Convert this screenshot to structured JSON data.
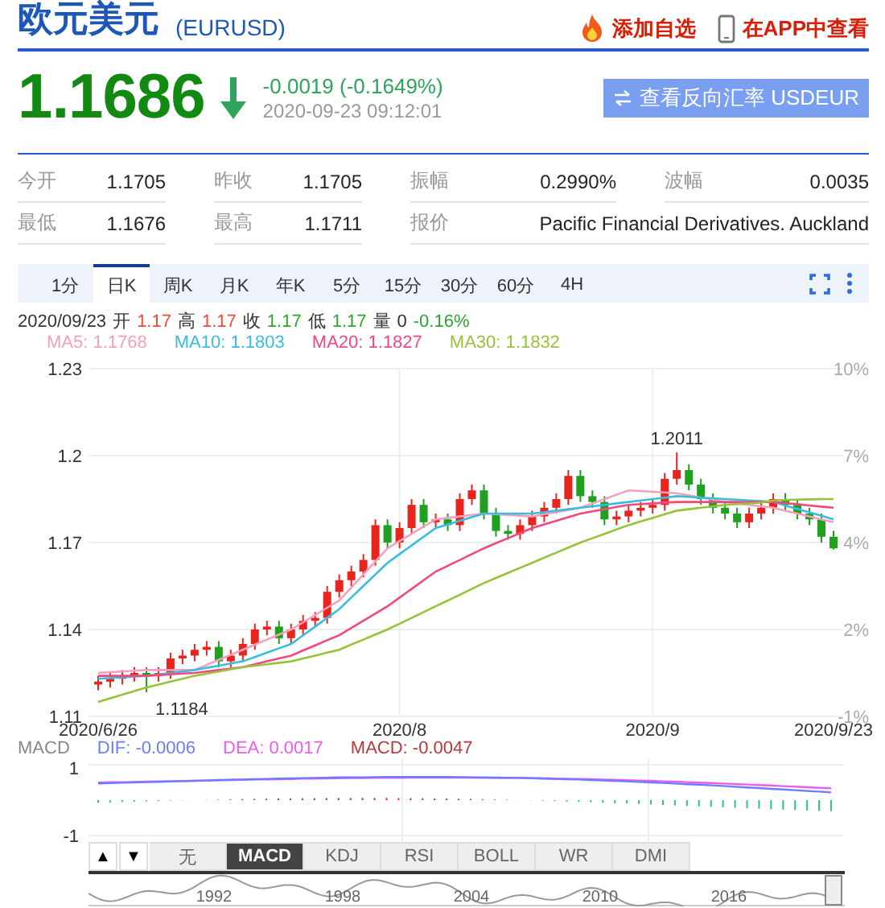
{
  "header": {
    "title": "欧元美元",
    "code": "(EURUSD)",
    "actions": [
      {
        "kind": "watch",
        "label": "添加自选"
      },
      {
        "kind": "app",
        "label": "在APP中查看"
      }
    ]
  },
  "quote": {
    "price": "1.1686",
    "falling": true,
    "change": "-0.0019 (-0.1649%)",
    "time": "2020-09-23 09:12:01",
    "reverse_button": "查看反向汇率 USDEUR"
  },
  "stats": [
    [
      {
        "label": "今开",
        "value": "1.1705"
      },
      {
        "label": "昨收",
        "value": "1.1705"
      },
      {
        "label": "振幅",
        "value": "0.2990%"
      },
      {
        "label": "波幅",
        "value": "0.0035"
      }
    ],
    [
      {
        "label": "最低",
        "value": "1.1676"
      },
      {
        "label": "最高",
        "value": "1.1711"
      },
      {
        "label": "报价",
        "value": "Pacific Financial Derivatives. Auckland"
      }
    ]
  ],
  "period_tabs": [
    {
      "label": "1分",
      "selected": false
    },
    {
      "label": "日K",
      "selected": true
    },
    {
      "label": "周K",
      "selected": false
    },
    {
      "label": "月K",
      "selected": false
    },
    {
      "label": "年K",
      "selected": false
    },
    {
      "label": "5分",
      "selected": false
    },
    {
      "label": "15分",
      "selected": false
    },
    {
      "label": "30分",
      "selected": false
    },
    {
      "label": "60分",
      "selected": false
    },
    {
      "label": "4H",
      "selected": false
    }
  ],
  "quote_line": {
    "date": "2020/09/23",
    "fields": [
      {
        "label": "开",
        "value": "1.17",
        "color": "#f04a3a"
      },
      {
        "label": "高",
        "value": "1.17",
        "color": "#f04a3a"
      },
      {
        "label": "收",
        "value": "1.17",
        "color": "#2ea52e"
      },
      {
        "label": "低",
        "value": "1.17",
        "color": "#2ea52e"
      },
      {
        "label": "量",
        "value": "0",
        "color": "#333333"
      },
      {
        "value": "-0.16%",
        "color": "#2ea52e"
      }
    ]
  },
  "price_chart": {
    "chart_data": {
      "type": "candlestick",
      "grid": true,
      "ylim": [
        1.11,
        1.23
      ],
      "categories": [
        "2020/6/26",
        null,
        null,
        null,
        null,
        null,
        null,
        null,
        null,
        null,
        null,
        null,
        null,
        null,
        null,
        null,
        null,
        null,
        null,
        null,
        null,
        null,
        null,
        null,
        null,
        "2020/8",
        null,
        null,
        null,
        null,
        null,
        null,
        null,
        null,
        null,
        null,
        null,
        null,
        null,
        null,
        null,
        null,
        null,
        null,
        null,
        null,
        "2020/9",
        null,
        null,
        null,
        null,
        null,
        null,
        null,
        null,
        null,
        null,
        null,
        null,
        null,
        null,
        "2020/9/23"
      ],
      "yticks": [
        {
          "value": 1.23,
          "label": "1.23"
        },
        {
          "value": 1.2,
          "label": "1.2"
        },
        {
          "value": 1.17,
          "label": "1.17"
        },
        {
          "value": 1.14,
          "label": "1.14"
        },
        {
          "value": 1.11,
          "label": "1.11"
        }
      ],
      "ohlc": [
        [
          1.121,
          1.124,
          1.119,
          1.122
        ],
        [
          1.122,
          1.125,
          1.12,
          1.123
        ],
        [
          1.123,
          1.126,
          1.121,
          1.124
        ],
        [
          1.124,
          1.127,
          1.122,
          1.125
        ],
        [
          1.125,
          1.127,
          1.1184,
          1.124
        ],
        [
          1.124,
          1.127,
          1.122,
          1.125
        ],
        [
          1.125,
          1.132,
          1.123,
          1.13
        ],
        [
          1.13,
          1.133,
          1.128,
          1.131
        ],
        [
          1.131,
          1.135,
          1.129,
          1.133
        ],
        [
          1.133,
          1.136,
          1.131,
          1.134
        ],
        [
          1.134,
          1.136,
          1.127,
          1.129
        ],
        [
          1.129,
          1.133,
          1.127,
          1.131
        ],
        [
          1.131,
          1.137,
          1.129,
          1.135
        ],
        [
          1.135,
          1.142,
          1.133,
          1.14
        ],
        [
          1.14,
          1.143,
          1.138,
          1.141
        ],
        [
          1.141,
          1.143,
          1.135,
          1.137
        ],
        [
          1.137,
          1.142,
          1.135,
          1.14
        ],
        [
          1.14,
          1.145,
          1.138,
          1.143
        ],
        [
          1.143,
          1.146,
          1.141,
          1.144
        ],
        [
          1.144,
          1.155,
          1.142,
          1.153
        ],
        [
          1.153,
          1.159,
          1.151,
          1.157
        ],
        [
          1.157,
          1.162,
          1.155,
          1.16
        ],
        [
          1.16,
          1.166,
          1.158,
          1.164
        ],
        [
          1.164,
          1.178,
          1.162,
          1.176
        ],
        [
          1.176,
          1.178,
          1.168,
          1.17
        ],
        [
          1.17,
          1.177,
          1.168,
          1.175
        ],
        [
          1.175,
          1.185,
          1.173,
          1.183
        ],
        [
          1.183,
          1.185,
          1.175,
          1.177
        ],
        [
          1.177,
          1.18,
          1.175,
          1.178
        ],
        [
          1.178,
          1.18,
          1.174,
          1.176
        ],
        [
          1.176,
          1.187,
          1.174,
          1.185
        ],
        [
          1.185,
          1.19,
          1.183,
          1.188
        ],
        [
          1.188,
          1.19,
          1.178,
          1.18
        ],
        [
          1.18,
          1.182,
          1.172,
          1.174
        ],
        [
          1.174,
          1.176,
          1.171,
          1.173
        ],
        [
          1.173,
          1.178,
          1.171,
          1.176
        ],
        [
          1.176,
          1.181,
          1.174,
          1.179
        ],
        [
          1.179,
          1.184,
          1.177,
          1.182
        ],
        [
          1.182,
          1.187,
          1.18,
          1.185
        ],
        [
          1.185,
          1.195,
          1.183,
          1.193
        ],
        [
          1.193,
          1.195,
          1.184,
          1.186
        ],
        [
          1.186,
          1.188,
          1.182,
          1.184
        ],
        [
          1.184,
          1.186,
          1.176,
          1.178
        ],
        [
          1.178,
          1.181,
          1.176,
          1.179
        ],
        [
          1.179,
          1.183,
          1.177,
          1.181
        ],
        [
          1.181,
          1.184,
          1.179,
          1.182
        ],
        [
          1.182,
          1.185,
          1.18,
          1.183
        ],
        [
          1.183,
          1.194,
          1.181,
          1.192
        ],
        [
          1.192,
          1.2011,
          1.19,
          1.195
        ],
        [
          1.195,
          1.197,
          1.188,
          1.19
        ],
        [
          1.19,
          1.192,
          1.183,
          1.185
        ],
        [
          1.185,
          1.187,
          1.18,
          1.182
        ],
        [
          1.182,
          1.184,
          1.178,
          1.18
        ],
        [
          1.18,
          1.182,
          1.175,
          1.177
        ],
        [
          1.177,
          1.182,
          1.175,
          1.18
        ],
        [
          1.18,
          1.184,
          1.178,
          1.182
        ],
        [
          1.182,
          1.187,
          1.18,
          1.185
        ],
        [
          1.185,
          1.187,
          1.181,
          1.183
        ],
        [
          1.183,
          1.185,
          1.178,
          1.18
        ],
        [
          1.18,
          1.182,
          1.176,
          1.178
        ],
        [
          1.178,
          1.18,
          1.17,
          1.172
        ],
        [
          1.172,
          1.174,
          1.1676,
          1.168
        ]
      ],
      "series": [
        {
          "name": "MA5",
          "type": "line",
          "color": "#f4a0bd",
          "values": [
            1.125,
            1.1253,
            1.1255,
            1.1258,
            1.126,
            1.126,
            1.126,
            1.126,
            1.126,
            1.1278,
            1.1295,
            1.1313,
            1.133,
            1.1348,
            1.1365,
            1.1383,
            1.14,
            1.1425,
            1.145,
            1.1475,
            1.15,
            1.1545,
            1.159,
            1.1635,
            1.168,
            1.1705,
            1.173,
            1.1755,
            1.178,
            1.1785,
            1.179,
            1.1795,
            1.18,
            1.1798,
            1.1795,
            1.1793,
            1.179,
            1.1798,
            1.1805,
            1.1813,
            1.182,
            1.1835,
            1.185,
            1.1865,
            1.188,
            1.1878,
            1.1875,
            1.1873,
            1.187,
            1.1863,
            1.1855,
            1.1848,
            1.184,
            1.1835,
            1.183,
            1.1825,
            1.182,
            1.181,
            1.18,
            1.179,
            1.178,
            1.177
          ]
        },
        {
          "name": "MA10",
          "type": "line",
          "color": "#38bde0",
          "values": [
            1.123,
            1.1233,
            1.1235,
            1.1238,
            1.124,
            1.1245,
            1.125,
            1.1255,
            1.126,
            1.1268,
            1.1275,
            1.1283,
            1.129,
            1.1305,
            1.132,
            1.1335,
            1.135,
            1.138,
            1.141,
            1.144,
            1.147,
            1.151,
            1.155,
            1.159,
            1.163,
            1.166,
            1.169,
            1.172,
            1.175,
            1.1763,
            1.1775,
            1.1788,
            1.18,
            1.18,
            1.18,
            1.18,
            1.18,
            1.1805,
            1.181,
            1.1815,
            1.182,
            1.1825,
            1.183,
            1.1835,
            1.184,
            1.1845,
            1.185,
            1.1855,
            1.186,
            1.1858,
            1.1855,
            1.1853,
            1.185,
            1.1848,
            1.1845,
            1.1843,
            1.184,
            1.1828,
            1.1816,
            1.1804,
            1.1792,
            1.178
          ]
        },
        {
          "name": "MA20",
          "type": "line",
          "color": "#f0487f",
          "values": [
            1.124,
            1.124,
            1.124,
            1.124,
            1.124,
            1.1243,
            1.1245,
            1.1248,
            1.125,
            1.1255,
            1.126,
            1.1265,
            1.127,
            1.128,
            1.129,
            1.13,
            1.131,
            1.1328,
            1.1345,
            1.1363,
            1.138,
            1.1405,
            1.143,
            1.1455,
            1.148,
            1.151,
            1.154,
            1.157,
            1.16,
            1.162,
            1.164,
            1.166,
            1.168,
            1.1698,
            1.1715,
            1.1733,
            1.175,
            1.1763,
            1.1775,
            1.1788,
            1.18,
            1.1808,
            1.1815,
            1.1823,
            1.183,
            1.1833,
            1.1835,
            1.1838,
            1.184,
            1.184,
            1.184,
            1.184,
            1.184,
            1.184,
            1.184,
            1.184,
            1.184,
            1.1836,
            1.1832,
            1.1828,
            1.1824,
            1.182
          ]
        },
        {
          "name": "MA30",
          "type": "line",
          "color": "#97c23a",
          "values": [
            1.115,
            1.1163,
            1.1175,
            1.1188,
            1.12,
            1.121,
            1.122,
            1.123,
            1.124,
            1.1248,
            1.1255,
            1.1263,
            1.127,
            1.1275,
            1.128,
            1.1285,
            1.129,
            1.13,
            1.131,
            1.132,
            1.133,
            1.1348,
            1.1365,
            1.1383,
            1.14,
            1.142,
            1.144,
            1.146,
            1.148,
            1.15,
            1.152,
            1.154,
            1.156,
            1.1578,
            1.1595,
            1.1613,
            1.163,
            1.1648,
            1.1665,
            1.1683,
            1.17,
            1.1715,
            1.173,
            1.1745,
            1.176,
            1.1773,
            1.1785,
            1.1798,
            1.181,
            1.1815,
            1.182,
            1.1825,
            1.183,
            1.1833,
            1.1835,
            1.1838,
            1.1845,
            1.1847,
            1.1848,
            1.1849,
            1.185,
            1.185
          ]
        }
      ],
      "annotations": [
        "1.2011",
        "1.1184"
      ]
    },
    "ma_readings": [
      ": 1.1768",
      ": 1.1803",
      ": 1.1827",
      ": 1.1832"
    ],
    "pct_labels": [
      "10%",
      "7%",
      "4%",
      "2%",
      "-1%"
    ]
  },
  "macd": {
    "title": "MACD",
    "values": [
      {
        "text": "DIF: -0.0006",
        "color": "#6a7cff"
      },
      {
        "text": "DEA: 0.0017",
        "color": "#ee5cee"
      },
      {
        "text": "MACD: -0.0047",
        "color": "#b83a3a"
      }
    ],
    "y_labels": [
      "1",
      "-1"
    ]
  },
  "scroll_buttons": [
    "▲",
    "▼"
  ],
  "indicator_tabs": [
    {
      "label": "无",
      "selected": false
    },
    {
      "label": "MACD",
      "selected": true
    },
    {
      "label": "KDJ",
      "selected": false
    },
    {
      "label": "RSI",
      "selected": false
    },
    {
      "label": "BOLL",
      "selected": false
    },
    {
      "label": "WR",
      "selected": false
    },
    {
      "label": "DMI",
      "selected": false
    }
  ],
  "navigator": {
    "years": [
      "1992",
      "1998",
      "2004",
      "2010",
      "2016"
    ]
  }
}
